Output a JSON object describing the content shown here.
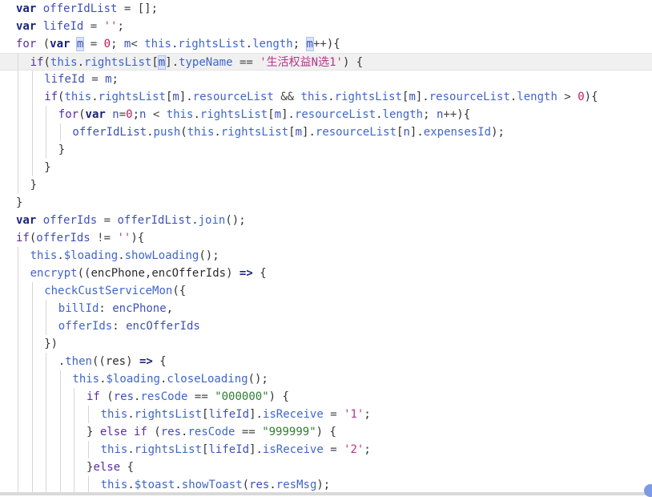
{
  "editor": {
    "lines": [
      {
        "indent": 0,
        "tokens": [
          [
            "kw",
            "var"
          ],
          [
            "plain",
            " "
          ],
          [
            "var",
            "offerIdList"
          ],
          [
            "op",
            " = "
          ],
          [
            "pun",
            "[];"
          ]
        ]
      },
      {
        "indent": 0,
        "tokens": [
          [
            "kw",
            "var"
          ],
          [
            "plain",
            " "
          ],
          [
            "var",
            "lifeId"
          ],
          [
            "op",
            " = "
          ],
          [
            "strq",
            "''"
          ],
          [
            "pun",
            ";"
          ]
        ]
      },
      {
        "indent": 0,
        "tokens": [
          [
            "kw2",
            "for"
          ],
          [
            "pun",
            " ("
          ],
          [
            "kw",
            "var"
          ],
          [
            "plain",
            " "
          ],
          [
            "selvar",
            "m"
          ],
          [
            "op",
            " = "
          ],
          [
            "num",
            "0"
          ],
          [
            "pun",
            "; "
          ],
          [
            "var",
            "m"
          ],
          [
            "op",
            "< "
          ],
          [
            "this",
            "this"
          ],
          [
            "pun",
            "."
          ],
          [
            "prop",
            "rightsList"
          ],
          [
            "pun",
            "."
          ],
          [
            "prop",
            "length"
          ],
          [
            "pun",
            "; "
          ],
          [
            "selvar",
            "m"
          ],
          [
            "op",
            "++"
          ],
          [
            "pun",
            "){"
          ]
        ]
      },
      {
        "indent": 1,
        "highlight": true,
        "tokens": [
          [
            "kw2",
            "if"
          ],
          [
            "pun",
            "("
          ],
          [
            "this",
            "this"
          ],
          [
            "pun",
            "."
          ],
          [
            "prop",
            "rightsList"
          ],
          [
            "pun",
            "["
          ],
          [
            "selvar",
            "m"
          ],
          [
            "pun",
            "]."
          ],
          [
            "prop",
            "typeName"
          ],
          [
            "op",
            " == "
          ],
          [
            "strq",
            "'生活权益N选1'"
          ],
          [
            "pun",
            ") {"
          ]
        ]
      },
      {
        "indent": 2,
        "tokens": [
          [
            "var",
            "lifeId"
          ],
          [
            "op",
            " = "
          ],
          [
            "var",
            "m"
          ],
          [
            "pun",
            ";"
          ]
        ]
      },
      {
        "indent": 2,
        "tokens": [
          [
            "kw2",
            "if"
          ],
          [
            "pun",
            "("
          ],
          [
            "this",
            "this"
          ],
          [
            "pun",
            "."
          ],
          [
            "prop",
            "rightsList"
          ],
          [
            "pun",
            "["
          ],
          [
            "var",
            "m"
          ],
          [
            "pun",
            "]."
          ],
          [
            "prop",
            "resourceList"
          ],
          [
            "op",
            " && "
          ],
          [
            "this",
            "this"
          ],
          [
            "pun",
            "."
          ],
          [
            "prop",
            "rightsList"
          ],
          [
            "pun",
            "["
          ],
          [
            "var",
            "m"
          ],
          [
            "pun",
            "]."
          ],
          [
            "prop",
            "resourceList"
          ],
          [
            "pun",
            "."
          ],
          [
            "prop",
            "length"
          ],
          [
            "op",
            " > "
          ],
          [
            "num",
            "0"
          ],
          [
            "pun",
            "){"
          ]
        ]
      },
      {
        "indent": 3,
        "tokens": [
          [
            "kw2",
            "for"
          ],
          [
            "pun",
            "("
          ],
          [
            "kw",
            "var"
          ],
          [
            "plain",
            " "
          ],
          [
            "var",
            "n"
          ],
          [
            "op",
            "="
          ],
          [
            "num",
            "0"
          ],
          [
            "pun",
            ";"
          ],
          [
            "var",
            "n"
          ],
          [
            "op",
            " < "
          ],
          [
            "this",
            "this"
          ],
          [
            "pun",
            "."
          ],
          [
            "prop",
            "rightsList"
          ],
          [
            "pun",
            "["
          ],
          [
            "var",
            "m"
          ],
          [
            "pun",
            "]."
          ],
          [
            "prop",
            "resourceList"
          ],
          [
            "pun",
            "."
          ],
          [
            "prop",
            "length"
          ],
          [
            "pun",
            "; "
          ],
          [
            "var",
            "n"
          ],
          [
            "op",
            "++"
          ],
          [
            "pun",
            "){"
          ]
        ]
      },
      {
        "indent": 4,
        "tokens": [
          [
            "var",
            "offerIdList"
          ],
          [
            "pun",
            "."
          ],
          [
            "fn",
            "push"
          ],
          [
            "pun",
            "("
          ],
          [
            "this",
            "this"
          ],
          [
            "pun",
            "."
          ],
          [
            "prop",
            "rightsList"
          ],
          [
            "pun",
            "["
          ],
          [
            "var",
            "m"
          ],
          [
            "pun",
            "]."
          ],
          [
            "prop",
            "resourceList"
          ],
          [
            "pun",
            "["
          ],
          [
            "var",
            "n"
          ],
          [
            "pun",
            "]."
          ],
          [
            "prop",
            "expensesId"
          ],
          [
            "pun",
            ");"
          ]
        ]
      },
      {
        "indent": 3,
        "tokens": [
          [
            "pun",
            "}"
          ]
        ]
      },
      {
        "indent": 2,
        "tokens": [
          [
            "pun",
            "}"
          ]
        ]
      },
      {
        "indent": 1,
        "tokens": [
          [
            "pun",
            "}"
          ]
        ]
      },
      {
        "indent": 0,
        "tokens": [
          [
            "pun",
            "}"
          ]
        ]
      },
      {
        "indent": 0,
        "tokens": [
          [
            "kw",
            "var"
          ],
          [
            "plain",
            " "
          ],
          [
            "var",
            "offerIds"
          ],
          [
            "op",
            " = "
          ],
          [
            "var",
            "offerIdList"
          ],
          [
            "pun",
            "."
          ],
          [
            "fn",
            "join"
          ],
          [
            "pun",
            "();"
          ]
        ]
      },
      {
        "indent": 0,
        "tokens": [
          [
            "kw2",
            "if"
          ],
          [
            "pun",
            "("
          ],
          [
            "var",
            "offerIds"
          ],
          [
            "op",
            " != "
          ],
          [
            "strq",
            "''"
          ],
          [
            "pun",
            "){"
          ]
        ]
      },
      {
        "indent": 1,
        "tokens": [
          [
            "this",
            "this"
          ],
          [
            "pun",
            "."
          ],
          [
            "prop",
            "$loading"
          ],
          [
            "pun",
            "."
          ],
          [
            "fn",
            "showLoading"
          ],
          [
            "pun",
            "();"
          ]
        ]
      },
      {
        "indent": 1,
        "tokens": [
          [
            "fn",
            "encrypt"
          ],
          [
            "pun",
            "(("
          ],
          [
            "param",
            "encPhone"
          ],
          [
            "pun",
            ","
          ],
          [
            "param",
            "encOfferIds"
          ],
          [
            "pun",
            ") "
          ],
          [
            "kw",
            "=>"
          ],
          [
            "pun",
            " {"
          ]
        ]
      },
      {
        "indent": 2,
        "tokens": [
          [
            "fn",
            "checkCustServiceMon"
          ],
          [
            "pun",
            "({"
          ]
        ]
      },
      {
        "indent": 3,
        "tokens": [
          [
            "key",
            "billId"
          ],
          [
            "pun",
            ": "
          ],
          [
            "var",
            "encPhone"
          ],
          [
            "pun",
            ","
          ]
        ]
      },
      {
        "indent": 3,
        "tokens": [
          [
            "key",
            "offerIds"
          ],
          [
            "pun",
            ": "
          ],
          [
            "var",
            "encOfferIds"
          ]
        ]
      },
      {
        "indent": 2,
        "tokens": [
          [
            "pun",
            "})"
          ]
        ]
      },
      {
        "indent": 3,
        "tokens": [
          [
            "pun",
            "."
          ],
          [
            "fn",
            "then"
          ],
          [
            "pun",
            "(("
          ],
          [
            "param",
            "res"
          ],
          [
            "pun",
            ") "
          ],
          [
            "kw",
            "=>"
          ],
          [
            "pun",
            " {"
          ]
        ]
      },
      {
        "indent": 4,
        "tokens": [
          [
            "this",
            "this"
          ],
          [
            "pun",
            "."
          ],
          [
            "prop",
            "$loading"
          ],
          [
            "pun",
            "."
          ],
          [
            "fn",
            "closeLoading"
          ],
          [
            "pun",
            "();"
          ]
        ]
      },
      {
        "indent": 5,
        "tokens": [
          [
            "kw2",
            "if"
          ],
          [
            "pun",
            " ("
          ],
          [
            "var",
            "res"
          ],
          [
            "pun",
            "."
          ],
          [
            "prop",
            "resCode"
          ],
          [
            "op",
            " == "
          ],
          [
            "str",
            "\"000000\""
          ],
          [
            "pun",
            ") {"
          ]
        ]
      },
      {
        "indent": 6,
        "tokens": [
          [
            "this",
            "this"
          ],
          [
            "pun",
            "."
          ],
          [
            "prop",
            "rightsList"
          ],
          [
            "pun",
            "["
          ],
          [
            "var",
            "lifeId"
          ],
          [
            "pun",
            "]."
          ],
          [
            "prop",
            "isReceive"
          ],
          [
            "op",
            " = "
          ],
          [
            "strq",
            "'1'"
          ],
          [
            "pun",
            ";"
          ]
        ]
      },
      {
        "indent": 5,
        "tokens": [
          [
            "pun",
            "} "
          ],
          [
            "kw2",
            "else if"
          ],
          [
            "pun",
            " ("
          ],
          [
            "var",
            "res"
          ],
          [
            "pun",
            "."
          ],
          [
            "prop",
            "resCode"
          ],
          [
            "op",
            " == "
          ],
          [
            "str",
            "\"999999\""
          ],
          [
            "pun",
            ") {"
          ]
        ]
      },
      {
        "indent": 6,
        "tokens": [
          [
            "this",
            "this"
          ],
          [
            "pun",
            "."
          ],
          [
            "prop",
            "rightsList"
          ],
          [
            "pun",
            "["
          ],
          [
            "var",
            "lifeId"
          ],
          [
            "pun",
            "]."
          ],
          [
            "prop",
            "isReceive"
          ],
          [
            "op",
            " = "
          ],
          [
            "strq",
            "'2'"
          ],
          [
            "pun",
            ";"
          ]
        ]
      },
      {
        "indent": 5,
        "tokens": [
          [
            "pun",
            "}"
          ],
          [
            "kw2",
            "else"
          ],
          [
            "pun",
            " {"
          ]
        ]
      },
      {
        "indent": 6,
        "tokens": [
          [
            "this",
            "this"
          ],
          [
            "pun",
            "."
          ],
          [
            "prop",
            "$toast"
          ],
          [
            "pun",
            "."
          ],
          [
            "fn",
            "showToast"
          ],
          [
            "pun",
            "("
          ],
          [
            "var",
            "res"
          ],
          [
            "pun",
            "."
          ],
          [
            "prop",
            "resMsg"
          ],
          [
            "pun",
            ");"
          ]
        ]
      }
    ]
  },
  "colors": {
    "background": "#ffffff",
    "current_line": "#f0f0f0",
    "selection": "#dbe4f9",
    "string": "#2e7d32",
    "number": "#c2185b",
    "keyword": "#1a237e"
  }
}
